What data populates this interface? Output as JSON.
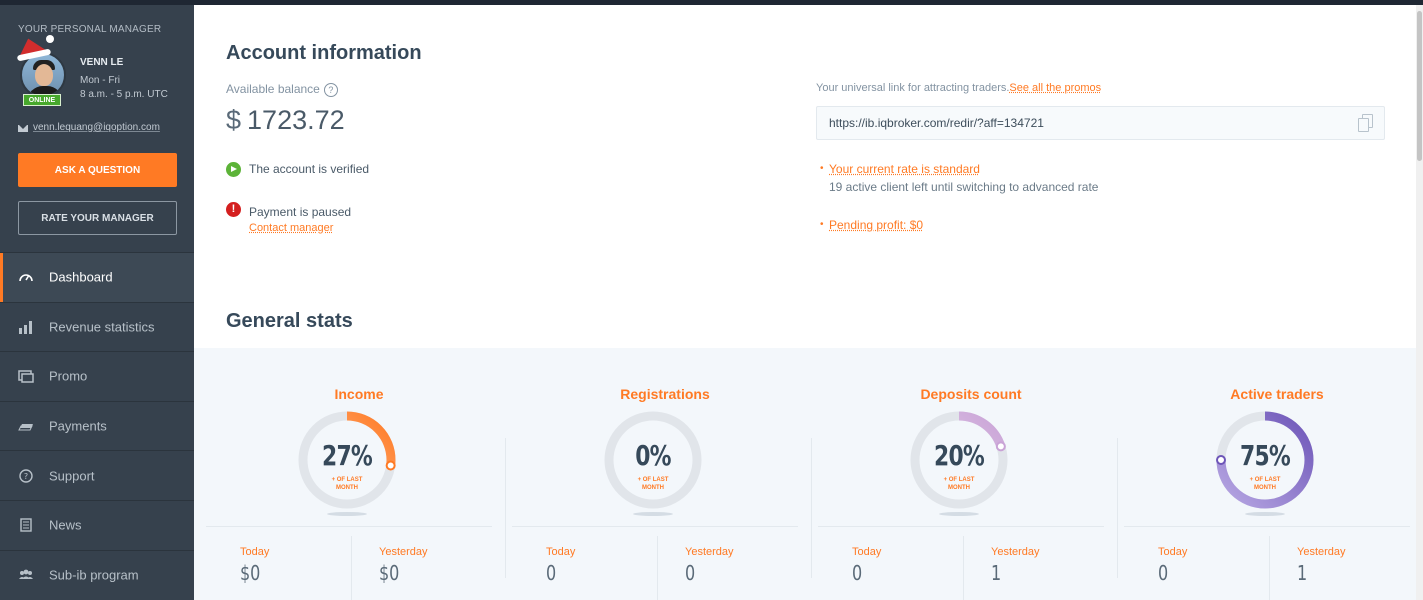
{
  "manager": {
    "section_title": "YOUR PERSONAL MANAGER",
    "name": "VENN LE",
    "days": "Mon - Fri",
    "hours": "8 a.m. - 5 p.m. UTC",
    "status": "ONLINE",
    "email": "venn.lequang@iqoption.com",
    "ask_label": "ASK A QUESTION",
    "rate_label": "RATE YOUR MANAGER"
  },
  "nav": [
    {
      "label": "Dashboard",
      "icon": "speedometer-icon",
      "active": true
    },
    {
      "label": "Revenue statistics",
      "icon": "bar-chart-icon",
      "active": false
    },
    {
      "label": "Promo",
      "icon": "promo-icon",
      "active": false
    },
    {
      "label": "Payments",
      "icon": "cash-icon",
      "active": false
    },
    {
      "label": "Support",
      "icon": "question-circle-icon",
      "active": false
    },
    {
      "label": "News",
      "icon": "newspaper-icon",
      "active": false
    },
    {
      "label": "Sub-ib program",
      "icon": "users-icon",
      "active": false
    }
  ],
  "account": {
    "title": "Account information",
    "balance_label": "Available balance",
    "help_glyph": "?",
    "currency": "$",
    "balance": "1723.72",
    "verified_text": "The account is verified",
    "paused_glyph": "!",
    "paused_text": "Payment is paused",
    "contact_label": "Contact manager",
    "link_label": "Your universal link for attracting traders.",
    "promos_label": "See all the promos",
    "link_value": "https://ib.iqbroker.com/redir/?aff=134721",
    "rate_label": "Your current rate is standard",
    "rate_desc": "19 active client left until switching to advanced rate",
    "pending_label": "Pending profit: $0",
    "bullet": "•"
  },
  "stats": {
    "title": "General stats",
    "sub_caption_line1": "+ OF LAST",
    "sub_caption_line2": "MONTH",
    "today_label": "Today",
    "yesterday_label": "Yesterday",
    "cards": [
      {
        "title": "Income",
        "percent": 27,
        "percent_text": "27%",
        "today": "$0",
        "yesterday": "$0",
        "ring_color": "#ff7a24",
        "ring_color_light": "#ffc9a3"
      },
      {
        "title": "Registrations",
        "percent": 0,
        "percent_text": "0%",
        "today": "0",
        "yesterday": "0",
        "ring_color": "#ff7a24",
        "ring_color_light": "#ffc9a3"
      },
      {
        "title": "Deposits count",
        "percent": 20,
        "percent_text": "20%",
        "today": "0",
        "yesterday": "1",
        "ring_color": "#c9a3d6",
        "ring_color_light": "#ead7f0"
      },
      {
        "title": "Active traders",
        "percent": 75,
        "percent_text": "75%",
        "today": "0",
        "yesterday": "1",
        "ring_color": "#6d55b8",
        "ring_color_light": "#b8a8e3"
      }
    ]
  },
  "colors": {
    "accent": "#ff7a24",
    "sidebar": "#36414d",
    "verified": "#5cb338",
    "error": "#d41f1f"
  }
}
